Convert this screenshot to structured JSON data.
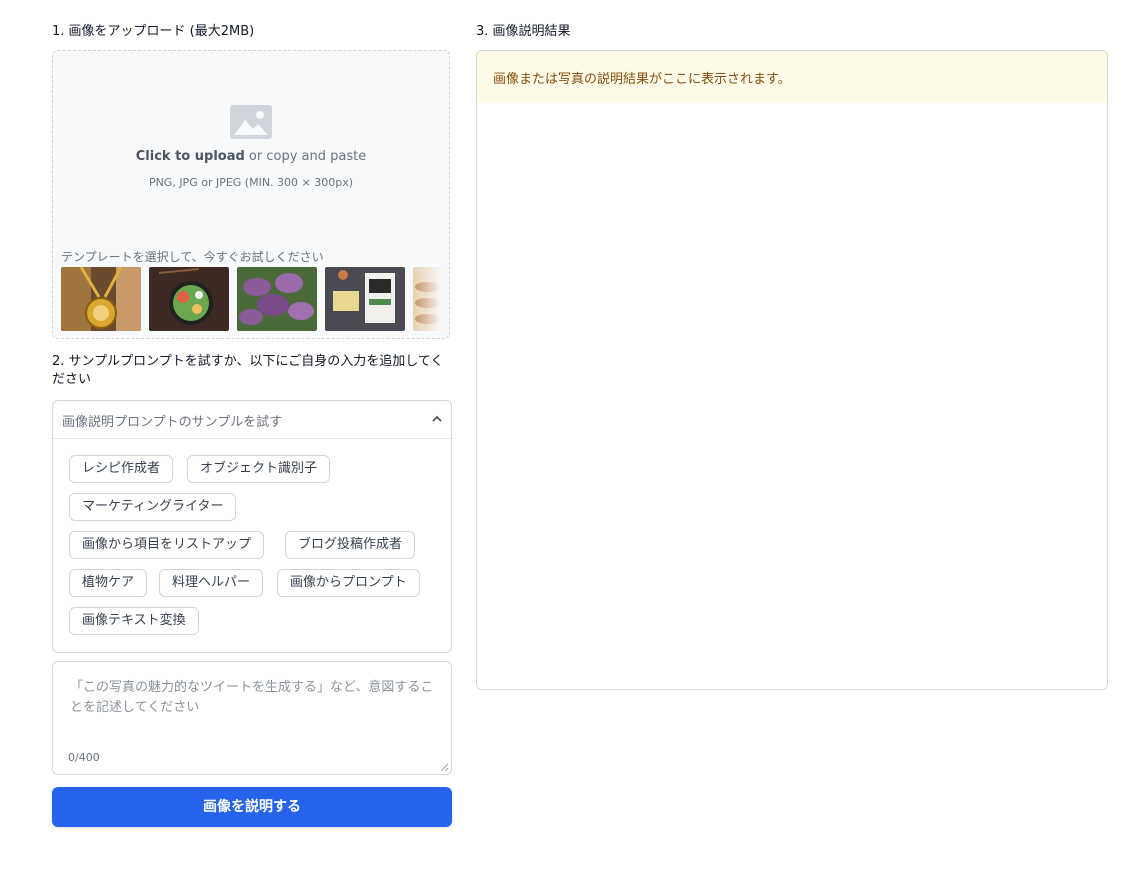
{
  "sections": {
    "upload_title": "1. 画像をアップロード (最大2MB)",
    "prompt_title": "2. サンプルプロンプトを試すか、以下にご自身の入力を追加してください",
    "result_title": "3. 画像説明結果"
  },
  "upload": {
    "icon": "image-icon",
    "click_text": "Click to upload",
    "or_text": " or copy and paste",
    "formats": "PNG, JPG or JPEG (MIN. 300 × 300px)",
    "template_label": "テンプレートを選択して、今すぐお試しください"
  },
  "accordion": {
    "header": "画像説明プロンプトのサンプルを試す",
    "chips": [
      "レシピ作成者",
      "オブジェクト識別子",
      "マーケティングライター",
      "画像から項目をリストアップ",
      "ブログ投稿作成者",
      "植物ケア",
      "料理ヘルパー",
      "画像からプロンプト",
      "画像テキスト変換"
    ]
  },
  "prompt": {
    "placeholder": "「この写真の魅力的なツイートを生成する」など、意図することを記述してください",
    "counter": "0/400"
  },
  "submit_label": "画像を説明する",
  "result": {
    "notice": "画像または写真の説明結果がここに表示されます。"
  },
  "colors": {
    "accent": "#2563eb",
    "notice_bg": "#fefce8",
    "notice_text": "#854d0e"
  }
}
